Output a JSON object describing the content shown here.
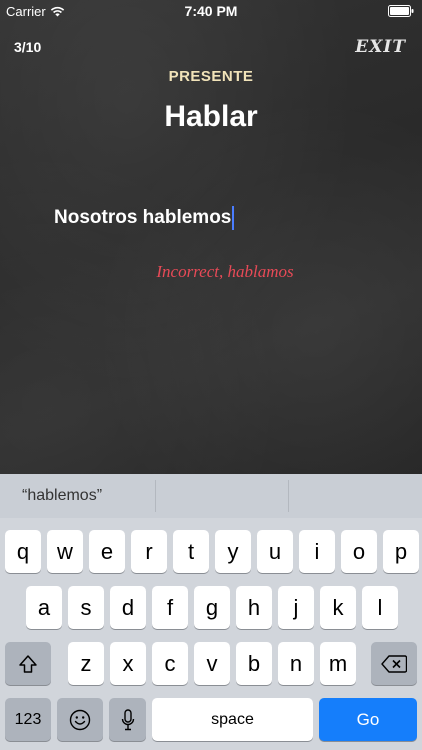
{
  "status_bar": {
    "carrier": "Carrier",
    "time": "7:40 PM"
  },
  "quiz": {
    "counter": "3/10",
    "exit_label": "EXIT",
    "tense": "PRESENTE",
    "verb": "Hablar",
    "answer": "Nosotros hablemos",
    "feedback": "Incorrect, hablamos"
  },
  "colors": {
    "tense": "#f1e3b9",
    "feedback": "#e84a57",
    "caret": "#4a7dff",
    "go_key": "#157efb"
  },
  "keyboard": {
    "suggestions": [
      "“hablemos”",
      "",
      ""
    ],
    "row1": [
      "q",
      "w",
      "e",
      "r",
      "t",
      "y",
      "u",
      "i",
      "o",
      "p"
    ],
    "row2": [
      "a",
      "s",
      "d",
      "f",
      "g",
      "h",
      "j",
      "k",
      "l"
    ],
    "row3": [
      "z",
      "x",
      "c",
      "v",
      "b",
      "n",
      "m"
    ],
    "numbers_label": "123",
    "space_label": "space",
    "go_label": "Go",
    "icons": {
      "shift": "shift-icon",
      "delete": "delete-icon",
      "emoji": "emoji-icon",
      "mic": "microphone-icon"
    }
  }
}
